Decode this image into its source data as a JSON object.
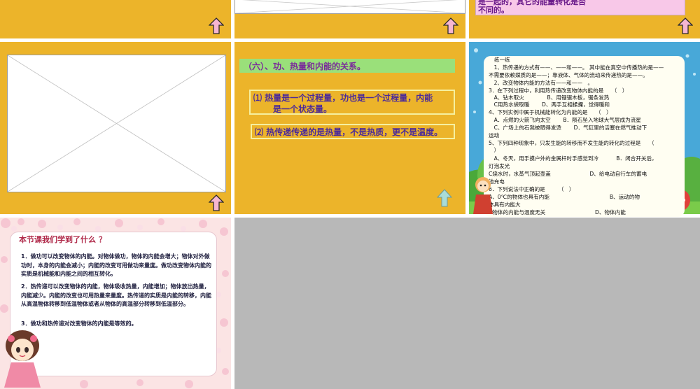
{
  "slides": {
    "s3": {
      "text_line1": "是一起的，其它的能量转化是否",
      "text_line2": "不同的。"
    },
    "s5": {
      "title": "（六）、功、热量和内能的关系。",
      "point1_line1": "⑴ 热量是一个过程量，功也是一个过程量，内能",
      "point1_line2": "是一个状态量。",
      "point2": "⑵ 热传递传递的是热量，不是热质，更不是温度。"
    },
    "s6": {
      "lines": [
        "练一练",
        "　1、热传递的方式有——、——和——。 其中能在真空中传播热的是——",
        "不需要依赖媒质的是——；靠液体、气体的流动来传递热的是——。",
        "　2、改变物体内能的方法有——和——　。",
        "3．在下列过程中，利用热传递改变物体内能的是　　（　）",
        "　A、钻木取火　　　　 B、用锯锯木板，锯条发热",
        "　C用热水袋取暖　　 D、两手互相揉搮，觉得暖和",
        "4、下列实例中属于机械能转化为内能的是　　（　）",
        "　A．点燃的火箭飞向太空　　 B．陨石坠入地球大气层成为流星",
        "　C、广场上的石凳被晒得发烫　　 D．气缸里的活塞在燃气推动下",
        "运动",
        "5、下列四种现象中，只发生能的转移而不发生能的转化的过程是　　（",
        "　）",
        "　A、冬天，用手摸户外的金属杆时手感觉到冷　　　 B．闭合开关后，",
        "灯泡发光",
        "C烧水时，水蒸气顶起壶盖　　　　　　　 D、给电动自行车的蓄电",
        "池充电",
        "6．下列说法中正确的是　　　（　）",
        "A、0℃的物体也具有内能　　　　　　　　　　　 B、运动的物",
        "体具有内能大",
        "C物体的内能与温度无关　　　　　　　　　 D、物体内能"
      ]
    },
    "s7": {
      "title": "本节课我们学到了什么 ？",
      "p1": "1．做功可以改变物体的内能。对物体做功，物体的内能会增大；物体对外做功时，本身的内能会减小；内能的改变可用做功来量度。做功改变物体内能的实质是机械能和内能之间的相互转化。",
      "p2": "2．热传递可以改变物体的内能，物体吸收热量，内能增加；物体放出热量，内能减少。内能的改变也可用热量来量度。热传递的实质是内能的转移，内能从高温物体转移到低温物体或者从物体的高温部分转移到低温部分。",
      "p3": "3．做功和热传递对改变物体的内能是等效的。"
    }
  },
  "icons": {
    "nav_up": "up-arrow-icon"
  },
  "colors": {
    "slide_bg": "#ecb42a",
    "arrow_pink": "#f6b6d2",
    "arrow_cyan": "#a9dcd8"
  }
}
